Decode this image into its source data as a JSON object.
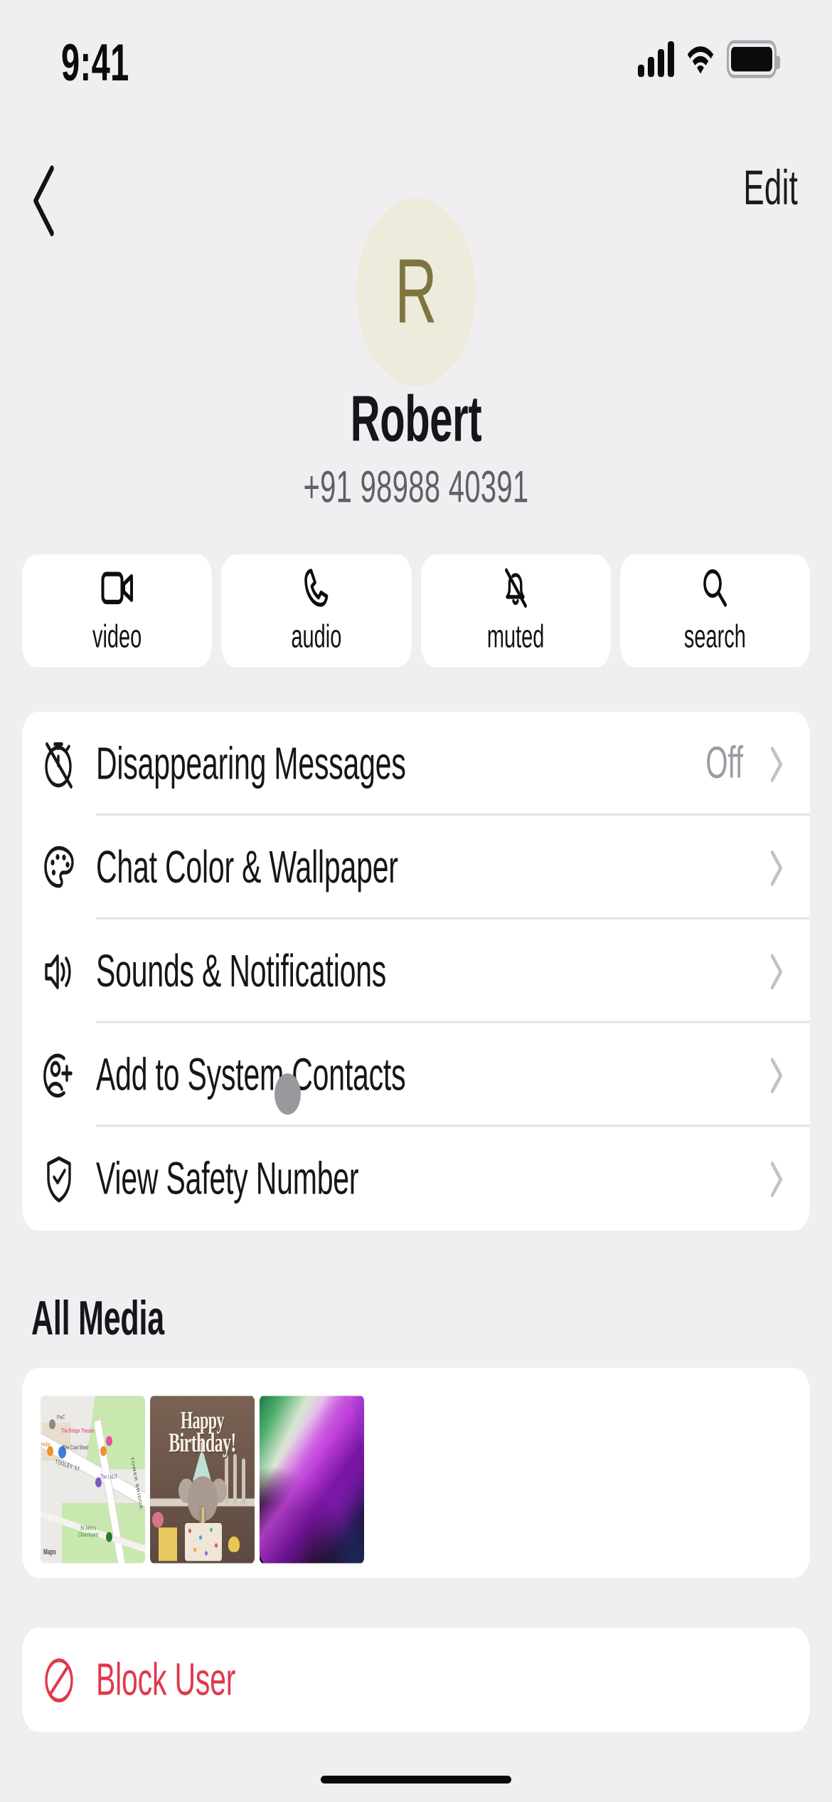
{
  "status_bar": {
    "time": "9:41",
    "signal_icon": "cellular-signal-icon",
    "wifi_icon": "wifi-icon",
    "battery_icon": "battery-icon"
  },
  "navbar": {
    "back_icon": "chevron-left-icon",
    "edit_label": "Edit"
  },
  "profile": {
    "avatar_initial": "R",
    "avatar_bg": "#EDEBDB",
    "avatar_fg": "#7E7440",
    "name": "Robert",
    "phone": "+91 98988 40391"
  },
  "actions": [
    {
      "label": "video",
      "icon": "video-camera-icon"
    },
    {
      "label": "audio",
      "icon": "phone-icon"
    },
    {
      "label": "muted",
      "icon": "bell-slash-icon"
    },
    {
      "label": "search",
      "icon": "magnifier-icon"
    }
  ],
  "settings": [
    {
      "label": "Disappearing Messages",
      "value": "Off",
      "icon": "timer-off-icon"
    },
    {
      "label": "Chat Color & Wallpaper",
      "value": "",
      "icon": "palette-icon"
    },
    {
      "label": "Sounds & Notifications",
      "value": "",
      "icon": "speaker-waves-icon"
    },
    {
      "label": "Add to System Contacts",
      "value": "",
      "icon": "person-add-icon"
    },
    {
      "label": "View Safety Number",
      "value": "",
      "icon": "shield-check-icon"
    }
  ],
  "media": {
    "section_title": "All Media",
    "items": [
      {
        "name": "map-thumbnail",
        "type": "map",
        "labels": [
          "PwC",
          "The Bridge Theatre",
          "medio",
          "The Coal Shed",
          "TOOLEY ST",
          "The LaLiT",
          "St John's Churchyard",
          "TOWER BRIDGE",
          "Maps"
        ]
      },
      {
        "name": "birthday-photo-thumbnail",
        "type": "photo",
        "caption_line1": "Happy",
        "caption_line2": "Birthday!"
      },
      {
        "name": "wallpaper-thumbnail",
        "type": "photo",
        "caption_line1": "",
        "caption_line2": ""
      }
    ]
  },
  "block": {
    "label": "Block User",
    "icon": "block-circle-icon",
    "color": "#E0394B"
  },
  "theme": {
    "page_bg": "#F0EEF1",
    "card_bg": "#FFFFFF",
    "text_primary": "#16161A",
    "text_secondary": "#5F5F64",
    "chevron": "#C2C1C6",
    "danger": "#E0394B"
  }
}
